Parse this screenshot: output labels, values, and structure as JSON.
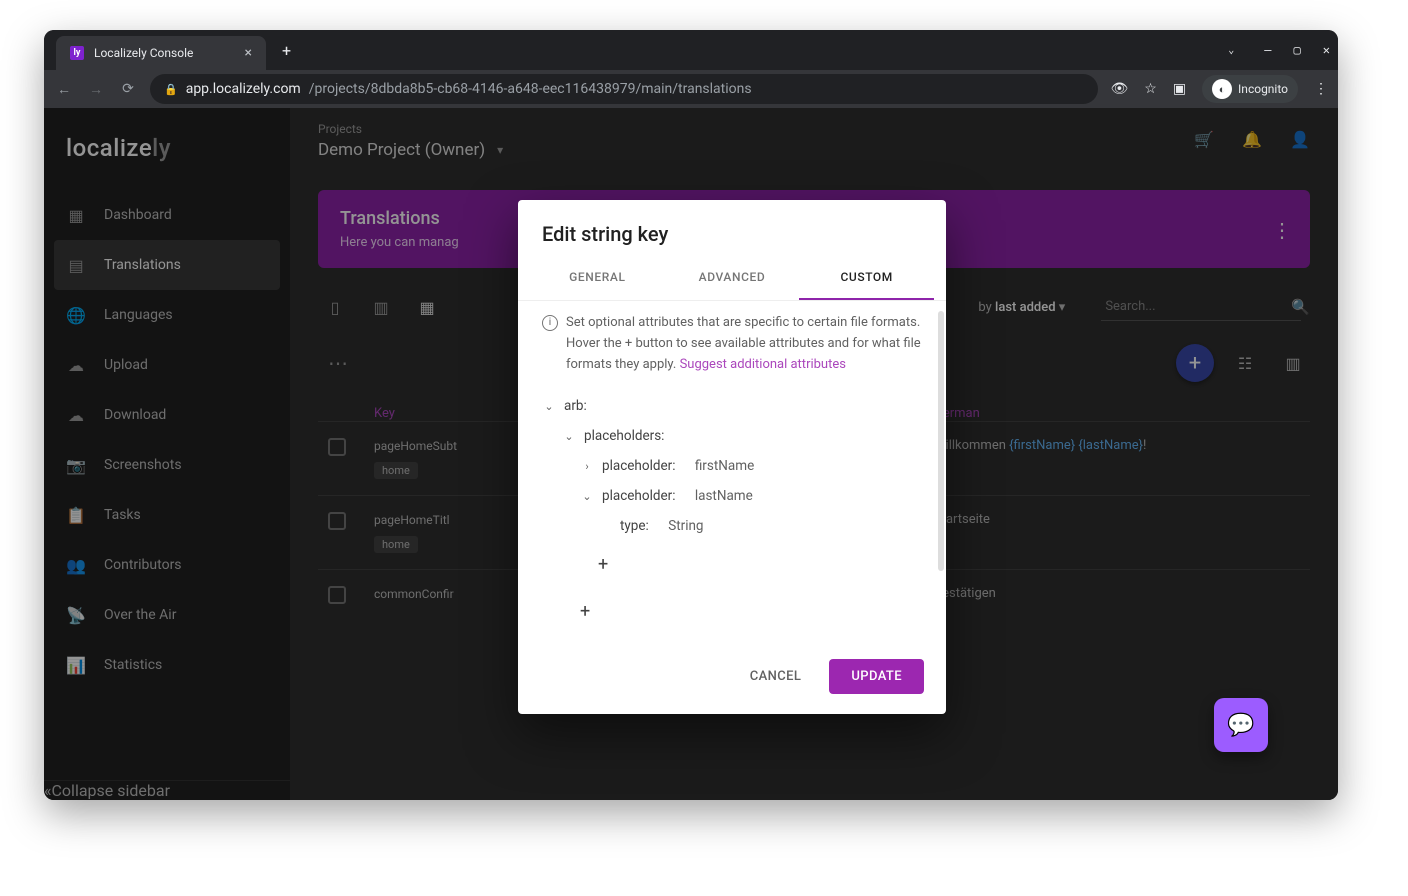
{
  "browser": {
    "tab_title": "Localizely Console",
    "url_host": "app.localizely.com",
    "url_path": "/projects/8dbda8b5-cb68-4146-a648-eec116438979/main/translations",
    "incognito_label": "Incognito"
  },
  "sidebar": {
    "logo_a": "localize",
    "logo_b": "ly",
    "items": [
      {
        "label": "Dashboard"
      },
      {
        "label": "Translations"
      },
      {
        "label": "Languages"
      },
      {
        "label": "Upload"
      },
      {
        "label": "Download"
      },
      {
        "label": "Screenshots"
      },
      {
        "label": "Tasks"
      },
      {
        "label": "Contributors"
      },
      {
        "label": "Over the Air"
      },
      {
        "label": "Statistics"
      }
    ],
    "collapse": "Collapse sidebar"
  },
  "header": {
    "crumb": "Projects",
    "project": "Demo Project (Owner)"
  },
  "banner": {
    "title": "Translations",
    "subtitle": "Here you can manag"
  },
  "toolbar": {
    "order_prefix": "by ",
    "order_value": "last added",
    "search_placeholder": "Search..."
  },
  "table": {
    "col_key": "Key",
    "col_lang": "German",
    "rows": [
      {
        "key": "pageHomeSubt",
        "tag": "home",
        "prefix": "Willkommen ",
        "p1": "{firstName}",
        "mid": " ",
        "p2": "{lastName}",
        "suffix": "!"
      },
      {
        "key": "pageHomeTitl",
        "tag": "home",
        "val": "Startseite"
      },
      {
        "key": "commonConfir",
        "tag": "",
        "val": "Bestätigen"
      }
    ]
  },
  "dialog": {
    "title": "Edit string key",
    "tabs": {
      "general": "GENERAL",
      "advanced": "ADVANCED",
      "custom": "CUSTOM"
    },
    "info_text": "Set optional attributes that are specific to certain file formats. Hover the + button to see available attributes and for what file formats they apply. ",
    "info_link": "Suggest additional attributes",
    "tree": {
      "arb": "arb:",
      "placeholders": "placeholders:",
      "placeholder_label": "placeholder:",
      "firstName": "firstName",
      "lastName": "lastName",
      "type_label": "type:",
      "type_value": "String"
    },
    "cancel": "CANCEL",
    "update": "UPDATE"
  }
}
